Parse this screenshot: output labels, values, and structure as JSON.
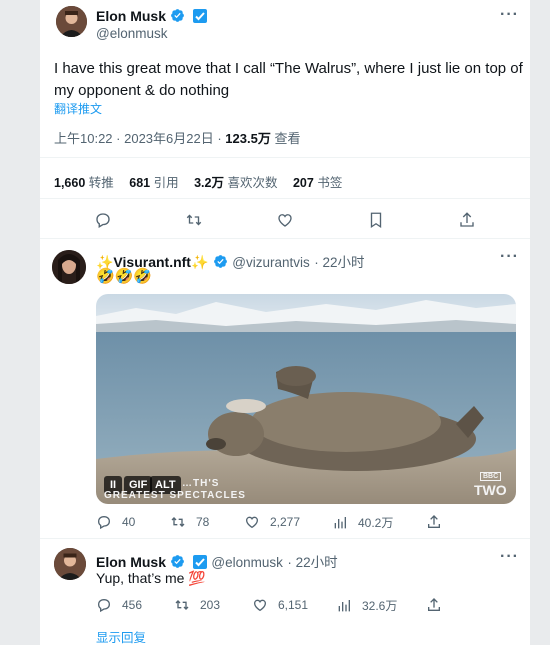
{
  "main_tweet": {
    "author_name": "Elon Musk",
    "handle": "@elonmusk",
    "text": "I have this great move that I call “The Walrus”, where I just lie on top of my opponent & do nothing",
    "translate_label": "翻译推文",
    "time": "上午10:22",
    "date": "2023年6月22日",
    "views_count": "123.5万",
    "views_label": "查看",
    "stats": {
      "retweets_count": "1,660",
      "retweets_label": "转推",
      "quotes_count": "681",
      "quotes_label": "引用",
      "likes_count": "3.2万",
      "likes_label": "喜欢次数",
      "bookmarks_count": "207",
      "bookmarks_label": "书签"
    }
  },
  "reply1": {
    "author_name": "✨Visurant.nft✨",
    "handle": "@vizurantvis",
    "time": "22小时",
    "text": "🤣🤣🤣",
    "media": {
      "gif_label": "GIF",
      "alt_label": "ALT",
      "pause_icon": "pause-icon",
      "watermark_line1": "…TH'S",
      "watermark_line2": "GREATEST SPECTACLES",
      "bbc_label": "BBC",
      "two_label": "TWO"
    },
    "replies": "40",
    "retweets": "78",
    "likes": "2,277",
    "views": "40.2万"
  },
  "reply2": {
    "author_name": "Elon Musk",
    "handle": "@elonmusk",
    "time": "22小时",
    "text": "Yup, that’s me",
    "emoji": "💯",
    "replies": "456",
    "retweets": "203",
    "likes": "6,151",
    "views": "32.6万"
  },
  "show_replies": "显示回复",
  "colors": {
    "accent": "#1d9bf0",
    "secondary_text": "#536471",
    "primary_text": "#0f1419",
    "verified_blue": "#1d9bf0",
    "affiliate_blue": "#1d9bf0"
  },
  "icons": [
    "more-icon",
    "verified-icon",
    "affiliate-icon",
    "reply-icon",
    "retweet-icon",
    "like-icon",
    "bookmark-icon",
    "share-icon",
    "views-icon",
    "pause-icon"
  ]
}
